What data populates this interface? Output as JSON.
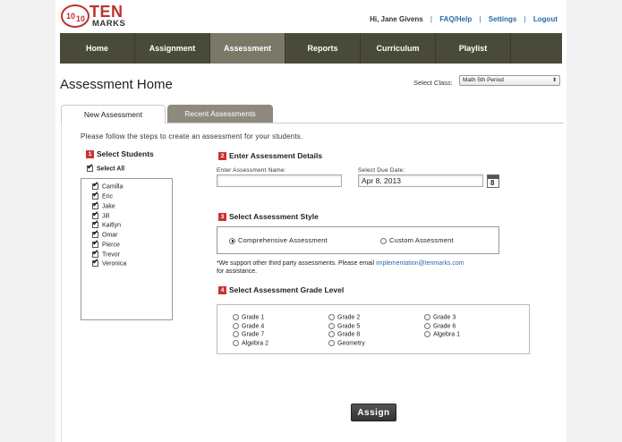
{
  "header": {
    "logo": {
      "main": "TEN",
      "sub": "MARKS",
      "emblem_left": "10",
      "emblem_right": "10"
    },
    "greeting": "Hi, Jane Givens",
    "links": [
      "FAQ/Help",
      "Settings",
      "Logout"
    ]
  },
  "nav": {
    "tabs": [
      {
        "label": "Home"
      },
      {
        "label": "Assignment"
      },
      {
        "label": "Assessment"
      },
      {
        "label": "Reports"
      },
      {
        "label": "Curriculum"
      },
      {
        "label": "Playlist"
      }
    ],
    "active": "Assessment"
  },
  "page": {
    "title": "Assessment Home",
    "select_class_label": "Select Class:",
    "selected_class": "Math 5th Period"
  },
  "tabs": {
    "new": "New Assessment",
    "recent": "Recent Assessments"
  },
  "intro": "Please follow the steps to create an assessment for your students.",
  "steps": {
    "s1": {
      "num": "1",
      "title": "Select Students"
    },
    "s2": {
      "num": "2",
      "title": "Enter Assessment Details"
    },
    "s3": {
      "num": "3",
      "title": "Select Assessment Style"
    },
    "s4": {
      "num": "4",
      "title": "Select Assessment Grade Level"
    }
  },
  "students": {
    "select_all": "Select All",
    "list": [
      "Camilla",
      "Eric",
      "Jake",
      "Jill",
      "Kaitlyn",
      "Omar",
      "Pierce",
      "Trevor",
      "Veronica"
    ]
  },
  "details": {
    "name_label": "Enter Assessment Name:",
    "name_value": "",
    "due_label": "Select Due Date:",
    "due_value": "Apr 8, 2013",
    "calendar_day": "8"
  },
  "style": {
    "options": [
      "Comprehensive Assessment",
      "Custom Assessment"
    ],
    "selected": "Comprehensive Assessment"
  },
  "note": {
    "text": "*We support other third party assessments. Please email",
    "email": "implementation@tenmarks.com",
    "tail": "for assistance."
  },
  "grades": [
    "Grade 1",
    "Grade 2",
    "Grade 3",
    "Grade 4",
    "Grade 5",
    "Grade 6",
    "Grade 7",
    "Grade 8",
    "Algebra 1",
    "Algebra 2",
    "Geometry"
  ],
  "assign_label": "Assign",
  "colors": {
    "nav_bg": "#4a4a3a",
    "nav_active": "#7b7868",
    "accent_red": "#cc3333",
    "link_blue": "#2a6aa8"
  }
}
